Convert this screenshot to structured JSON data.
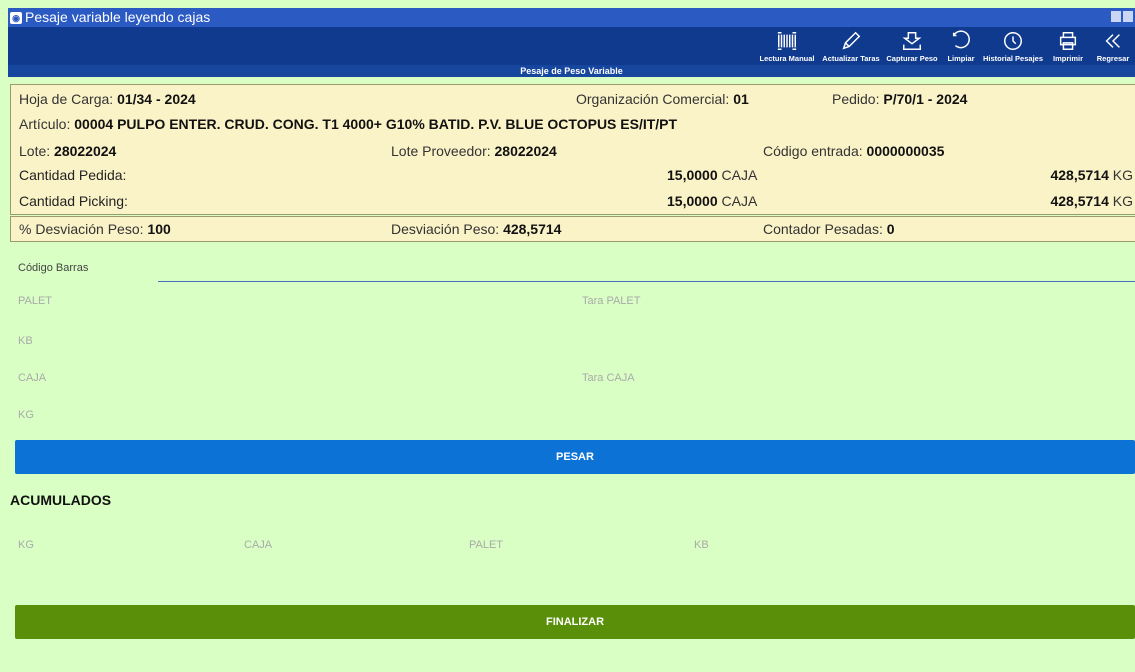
{
  "window": {
    "title": "Pesaje variable leyendo cajas",
    "icon": "app-icon"
  },
  "toolbar": {
    "items": [
      {
        "label": "Lectura Manual",
        "icon": "barcode-icon"
      },
      {
        "label": "Actualizar Taras",
        "icon": "pencil-icon"
      },
      {
        "label": "Capturar Peso",
        "icon": "scale-icon"
      },
      {
        "label": "Limpiar",
        "icon": "undo-icon"
      },
      {
        "label": "Historial Pesajes",
        "icon": "clock-icon"
      },
      {
        "label": "Imprimir",
        "icon": "printer-icon"
      },
      {
        "label": "Regresar",
        "icon": "back-icon"
      }
    ]
  },
  "subheader": "Pesaje de Peso Variable",
  "info": {
    "hoja_label": "Hoja de Carga:",
    "hoja_value": "01/34 - 2024",
    "org_label": "Organización Comercial:",
    "org_value": "01",
    "pedido_label": "Pedido:",
    "pedido_value": "P/70/1 - 2024",
    "articulo_label": "Artículo:",
    "articulo_value": "00004 PULPO ENTER. CRUD. CONG. T1 4000+ G10% BATID. P.V. BLUE OCTOPUS ES/IT/PT",
    "lote_label": "Lote:",
    "lote_value": "28022024",
    "lote_prov_label": "Lote Proveedor:",
    "lote_prov_value": "28022024",
    "codigo_label": "Código entrada:",
    "codigo_value": "0000000035",
    "pedida_label": "Cantidad Pedida:",
    "pedida_qty": "15,0000",
    "pedida_unit": "CAJA",
    "pedida_kg": "428,5714",
    "pedida_kg_unit": "KG",
    "picking_label": "Cantidad Picking:",
    "picking_qty": "15,0000",
    "picking_unit": "CAJA",
    "picking_kg": "428,5714",
    "picking_kg_unit": "KG"
  },
  "deviation": {
    "pct_label": "% Desviación Peso:",
    "pct_value": "100",
    "dev_label": "Desviación Peso:",
    "dev_value": "428,5714",
    "counter_label": "Contador Pesadas:",
    "counter_value": "0"
  },
  "form": {
    "barcode_label": "Código Barras",
    "barcode_value": "",
    "palet": "PALET",
    "tara_palet": "Tara PALET",
    "kb": "KB",
    "caja": "CAJA",
    "tara_caja": "Tara CAJA",
    "kg": "KG"
  },
  "pesar_button": "PESAR",
  "acumulados": {
    "title": "ACUMULADOS",
    "kg": "KG",
    "caja": "CAJA",
    "palet": "PALET",
    "kb": "KB"
  },
  "finalizar_button": "FINALIZAR",
  "colors": {
    "titlebar": "#2b5ac2",
    "toolbar": "#0f3a8e",
    "background": "#d9ffc4",
    "info_bg": "#fbf3c8",
    "pesar": "#0d72d6",
    "finalizar": "#5a8f0a"
  }
}
